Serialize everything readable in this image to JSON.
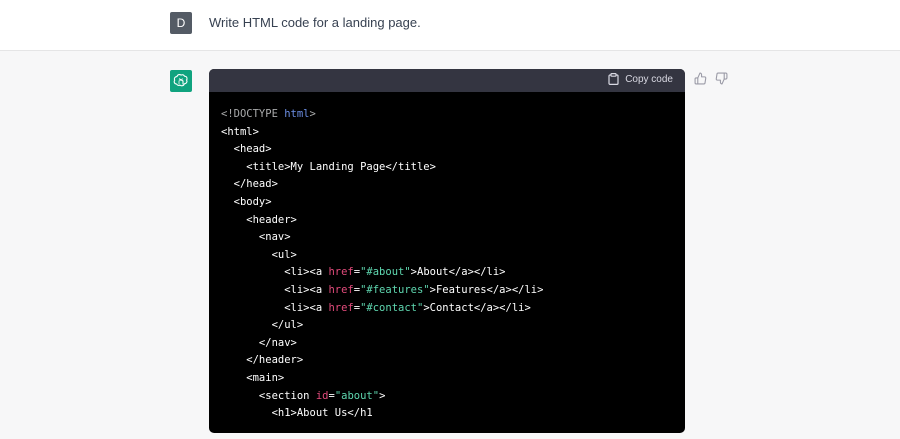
{
  "user": {
    "avatar_letter": "D",
    "message": "Write HTML code for a landing page."
  },
  "assistant": {
    "avatar_icon": "openai-logo-icon",
    "copy_label": "Copy code",
    "feedback": [
      "thumbs-up-icon",
      "thumbs-down-icon"
    ],
    "code_lines": [
      [
        [
          "doctype",
          "<!DOCTYPE "
        ],
        [
          "kw",
          "html"
        ],
        [
          "doctype",
          ">"
        ]
      ],
      [
        [
          "tag",
          "<html>"
        ]
      ],
      [
        [
          "tag",
          "  <head>"
        ]
      ],
      [
        [
          "tag",
          "    <title>My Landing Page</title>"
        ]
      ],
      [
        [
          "tag",
          "  </head>"
        ]
      ],
      [
        [
          "tag",
          "  <body>"
        ]
      ],
      [
        [
          "tag",
          "    <header>"
        ]
      ],
      [
        [
          "tag",
          "      <nav>"
        ]
      ],
      [
        [
          "tag",
          "        <ul>"
        ]
      ],
      [
        [
          "tag",
          "          <li><a "
        ],
        [
          "attr",
          "href"
        ],
        [
          "tag",
          "="
        ],
        [
          "str",
          "\"#about\""
        ],
        [
          "tag",
          ">About</a></li>"
        ]
      ],
      [
        [
          "tag",
          "          <li><a "
        ],
        [
          "attr",
          "href"
        ],
        [
          "tag",
          "="
        ],
        [
          "str",
          "\"#features\""
        ],
        [
          "tag",
          ">Features</a></li>"
        ]
      ],
      [
        [
          "tag",
          "          <li><a "
        ],
        [
          "attr",
          "href"
        ],
        [
          "tag",
          "="
        ],
        [
          "str",
          "\"#contact\""
        ],
        [
          "tag",
          ">Contact</a></li>"
        ]
      ],
      [
        [
          "tag",
          "        </ul>"
        ]
      ],
      [
        [
          "tag",
          "      </nav>"
        ]
      ],
      [
        [
          "tag",
          "    </header>"
        ]
      ],
      [
        [
          "tag",
          "    <main>"
        ]
      ],
      [
        [
          "tag",
          "      <section "
        ],
        [
          "attr",
          "id"
        ],
        [
          "tag",
          "="
        ],
        [
          "str",
          "\"about\""
        ],
        [
          "tag",
          ">"
        ]
      ],
      [
        [
          "tag",
          "        <h1>About Us</h1"
        ]
      ]
    ]
  },
  "colors": {
    "user_avatar_bg": "#545b65",
    "assistant_avatar_bg": "#10a37f",
    "code_bg": "#000000",
    "code_header_bg": "#343541",
    "assistant_row_bg": "#f7f7f8"
  }
}
